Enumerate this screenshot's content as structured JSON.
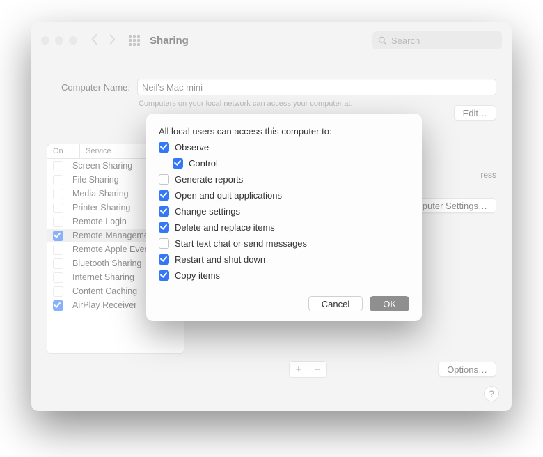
{
  "toolbar": {
    "title": "Sharing",
    "search_placeholder": "Search"
  },
  "computer_name": {
    "label": "Computer Name:",
    "value": "Neil's Mac mini",
    "subtext": "Computers on your local network can access your computer at:",
    "edit_label": "Edit…"
  },
  "services": {
    "header_on": "On",
    "header_service": "Service",
    "items": [
      {
        "checked": false,
        "label": "Screen Sharing"
      },
      {
        "checked": false,
        "label": "File Sharing"
      },
      {
        "checked": false,
        "label": "Media Sharing"
      },
      {
        "checked": false,
        "label": "Printer Sharing"
      },
      {
        "checked": false,
        "label": "Remote Login"
      },
      {
        "checked": true,
        "label": "Remote Management",
        "selected": true
      },
      {
        "checked": false,
        "label": "Remote Apple Events"
      },
      {
        "checked": false,
        "label": "Bluetooth Sharing"
      },
      {
        "checked": false,
        "label": "Internet Sharing"
      },
      {
        "checked": false,
        "label": "Content Caching"
      },
      {
        "checked": true,
        "label": "AirPlay Receiver"
      }
    ]
  },
  "right": {
    "address_suffix": "ress",
    "computer_settings_label": "Computer Settings…",
    "options_label": "Options…"
  },
  "sheet": {
    "title": "All local users can access this computer to:",
    "perms": [
      {
        "checked": true,
        "label": "Observe"
      },
      {
        "checked": true,
        "label": "Control",
        "indent": true
      },
      {
        "checked": false,
        "label": "Generate reports"
      },
      {
        "checked": true,
        "label": "Open and quit applications"
      },
      {
        "checked": true,
        "label": "Change settings"
      },
      {
        "checked": true,
        "label": "Delete and replace items"
      },
      {
        "checked": false,
        "label": "Start text chat or send messages"
      },
      {
        "checked": true,
        "label": "Restart and shut down"
      },
      {
        "checked": true,
        "label": "Copy items"
      }
    ],
    "cancel_label": "Cancel",
    "ok_label": "OK"
  }
}
